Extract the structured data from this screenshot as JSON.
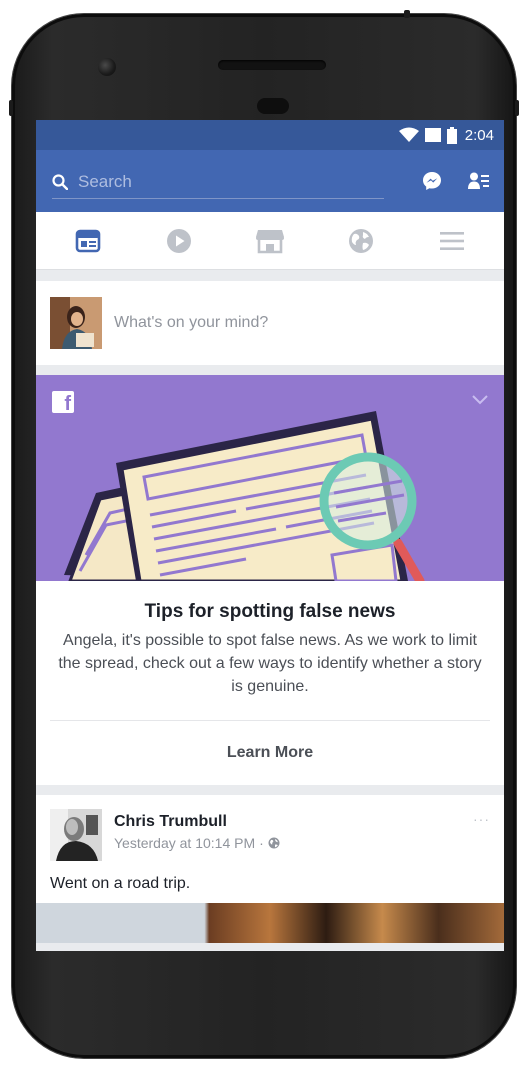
{
  "status_bar": {
    "time": "2:04"
  },
  "top_bar": {
    "search_placeholder": "Search"
  },
  "nav_tabs": [
    {
      "name": "news-feed",
      "icon": "news-feed-icon",
      "active": true
    },
    {
      "name": "watch",
      "icon": "play-icon",
      "active": false
    },
    {
      "name": "marketplace",
      "icon": "marketplace-icon",
      "active": false
    },
    {
      "name": "notifications",
      "icon": "globe-icon",
      "active": false
    },
    {
      "name": "menu",
      "icon": "menu-icon",
      "active": false
    }
  ],
  "composer": {
    "placeholder": "What's on your mind?"
  },
  "promo": {
    "title": "Tips for spotting false news",
    "description": "Angela, it's possible to spot false news. As we work to limit the spread, check out a few ways to identify whether a story is genuine.",
    "cta_label": "Learn More"
  },
  "post": {
    "author": "Chris Trumbull",
    "timestamp": "Yesterday at 10:14 PM",
    "separator": "·",
    "more": "···",
    "text": "Went on a road trip."
  },
  "colors": {
    "brand_blue": "#4267b2",
    "status_blue": "#365899",
    "promo_purple": "#9278cf",
    "active_tab": "#4267b2",
    "inactive_tab": "#bec2c9"
  }
}
